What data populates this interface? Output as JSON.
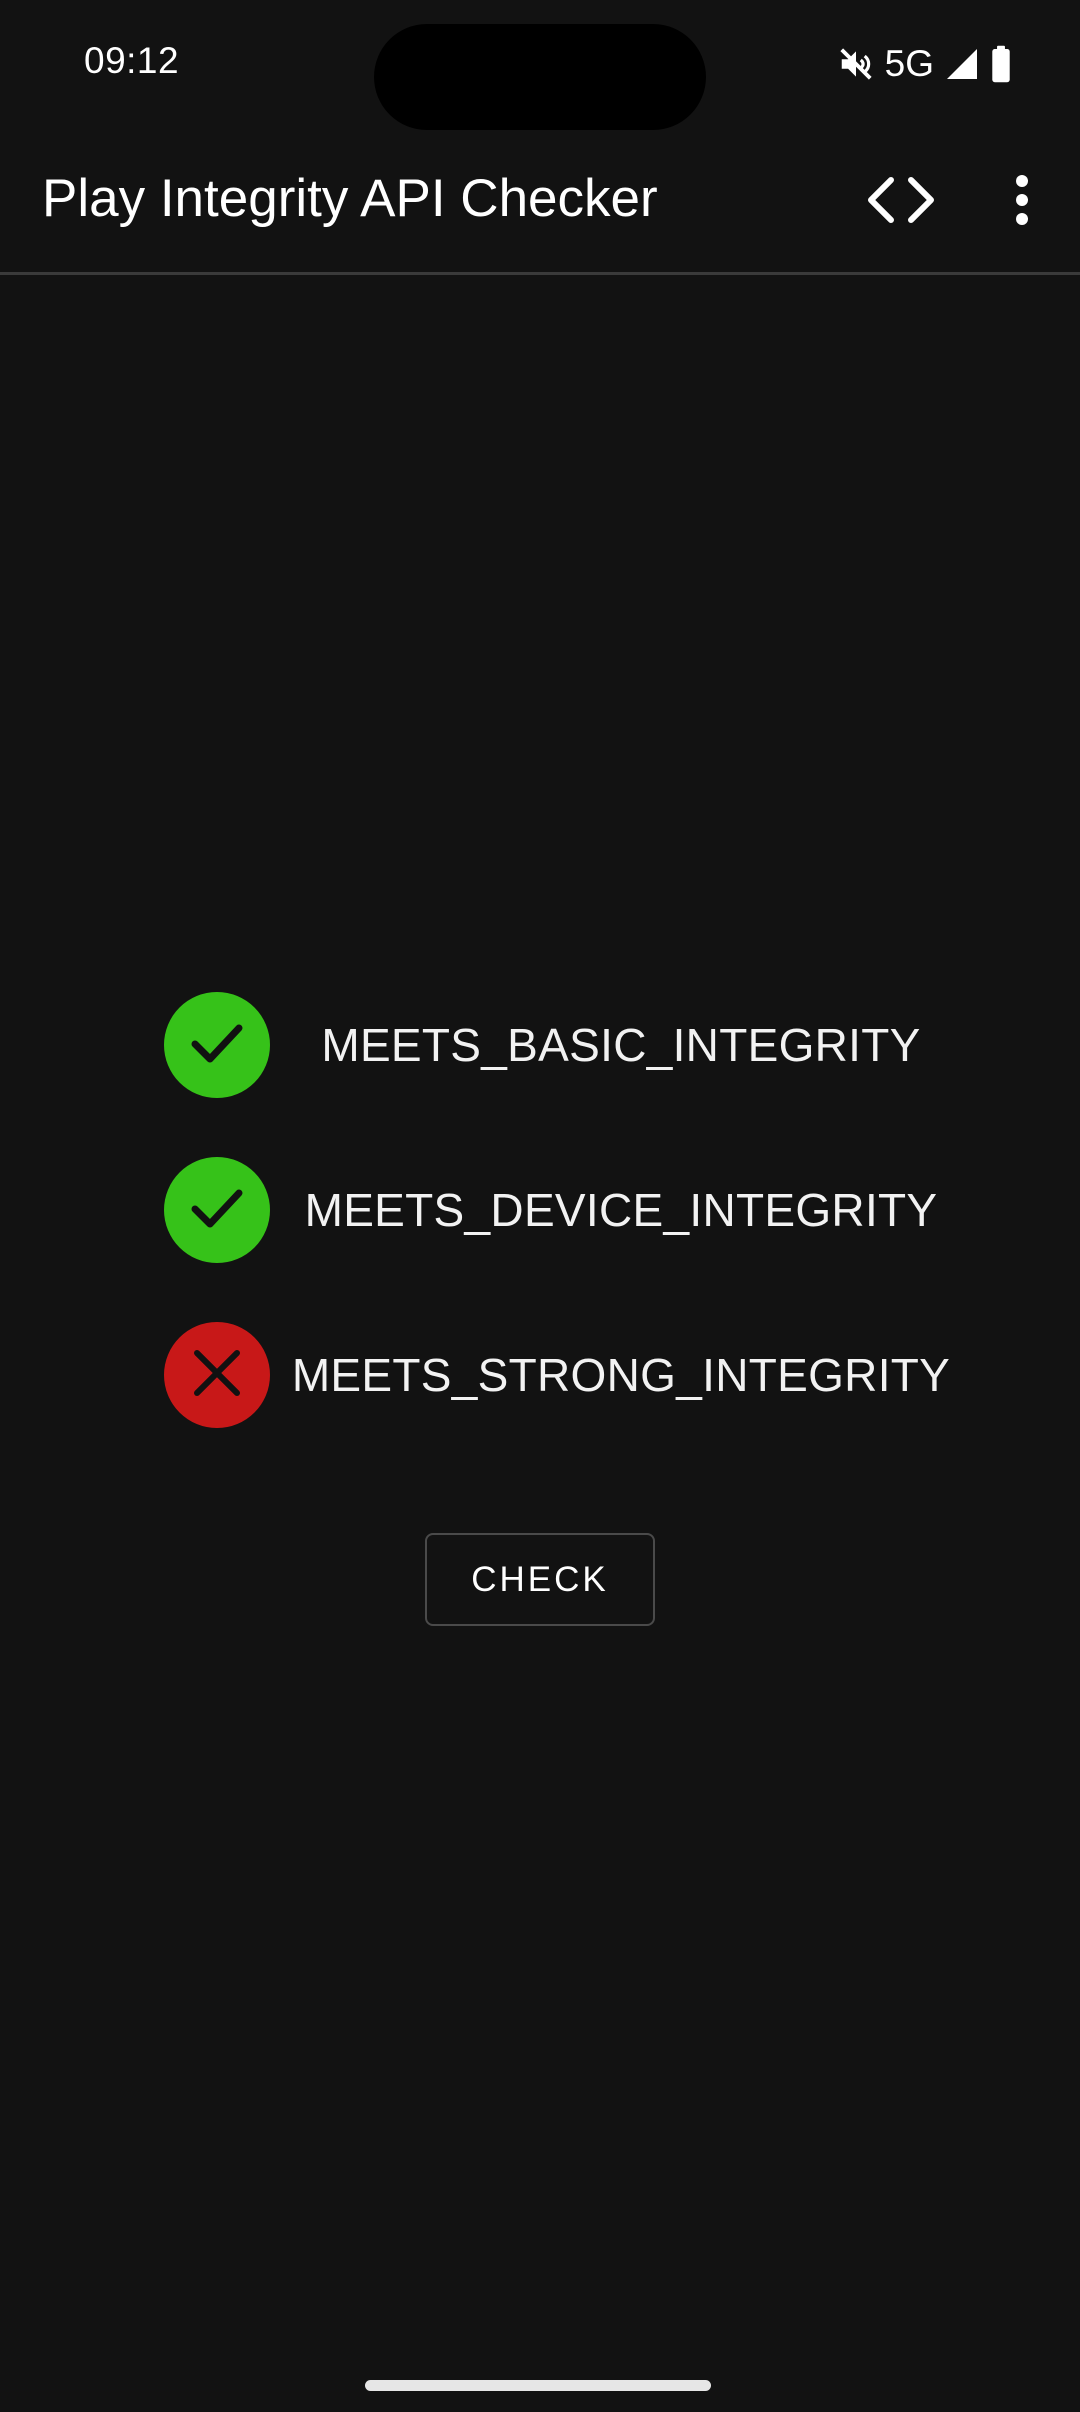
{
  "status_bar": {
    "time": "09:12",
    "network": "5G",
    "icons": [
      "mute-icon",
      "signal-icon",
      "battery-icon"
    ]
  },
  "app_bar": {
    "title": "Play Integrity API Checker",
    "actions": [
      "code-icon",
      "more-vert-icon"
    ]
  },
  "results": [
    {
      "label": "MEETS_BASIC_INTEGRITY",
      "status": "pass",
      "icon": "check-icon"
    },
    {
      "label": "MEETS_DEVICE_INTEGRITY",
      "status": "pass",
      "icon": "check-icon"
    },
    {
      "label": "MEETS_STRONG_INTEGRITY",
      "status": "fail",
      "icon": "close-icon"
    }
  ],
  "check_button": {
    "label": "CHECK"
  },
  "colors": {
    "background": "#121212",
    "pass": "#36c219",
    "fail": "#c81818",
    "text": "#ffffff"
  }
}
